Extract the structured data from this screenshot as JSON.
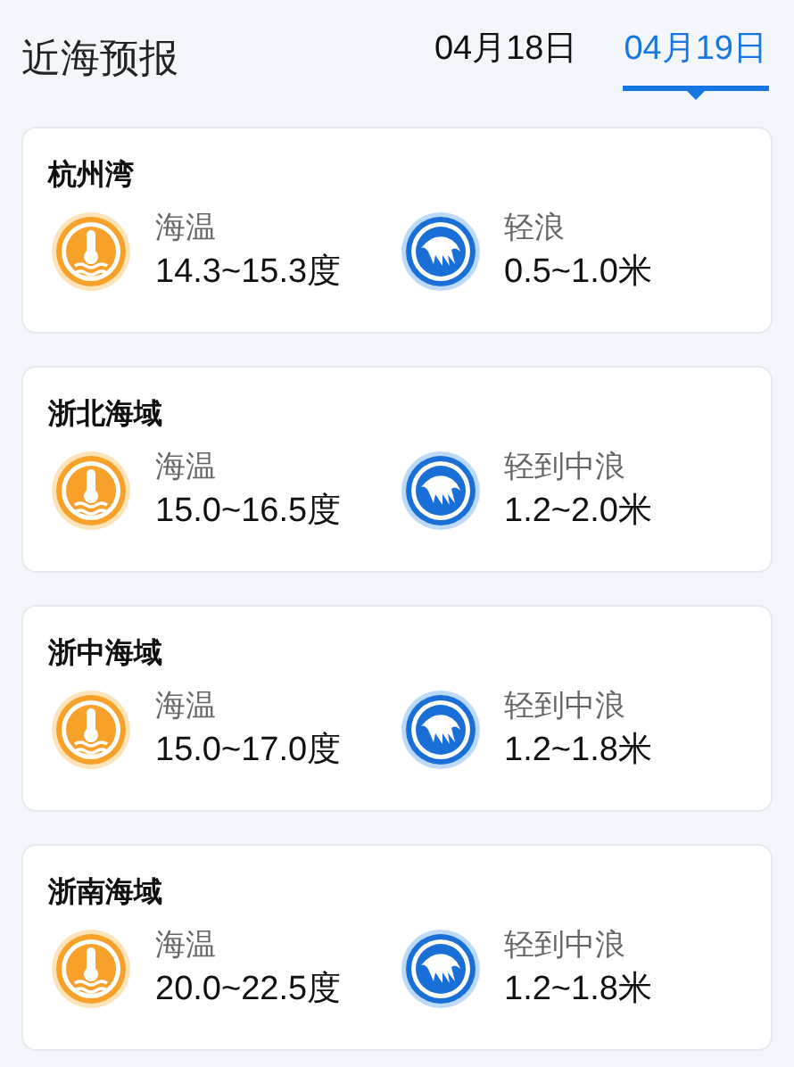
{
  "title": "近海预报",
  "tabs": [
    {
      "label": "04月18日",
      "selected": false
    },
    {
      "label": "04月19日",
      "selected": true
    }
  ],
  "regions": [
    {
      "name": "杭州湾",
      "temp_label": "海温",
      "temp": "14.3~15.3度",
      "wave_label": "轻浪",
      "wave": "0.5~1.0米"
    },
    {
      "name": "浙北海域",
      "temp_label": "海温",
      "temp": "15.0~16.5度",
      "wave_label": "轻到中浪",
      "wave": "1.2~2.0米"
    },
    {
      "name": "浙中海域",
      "temp_label": "海温",
      "temp": "15.0~17.0度",
      "wave_label": "轻到中浪",
      "wave": "1.2~1.8米"
    },
    {
      "name": "浙南海域",
      "temp_label": "海温",
      "temp": "20.0~22.5度",
      "wave_label": "轻到中浪",
      "wave": "1.2~1.8米"
    }
  ]
}
